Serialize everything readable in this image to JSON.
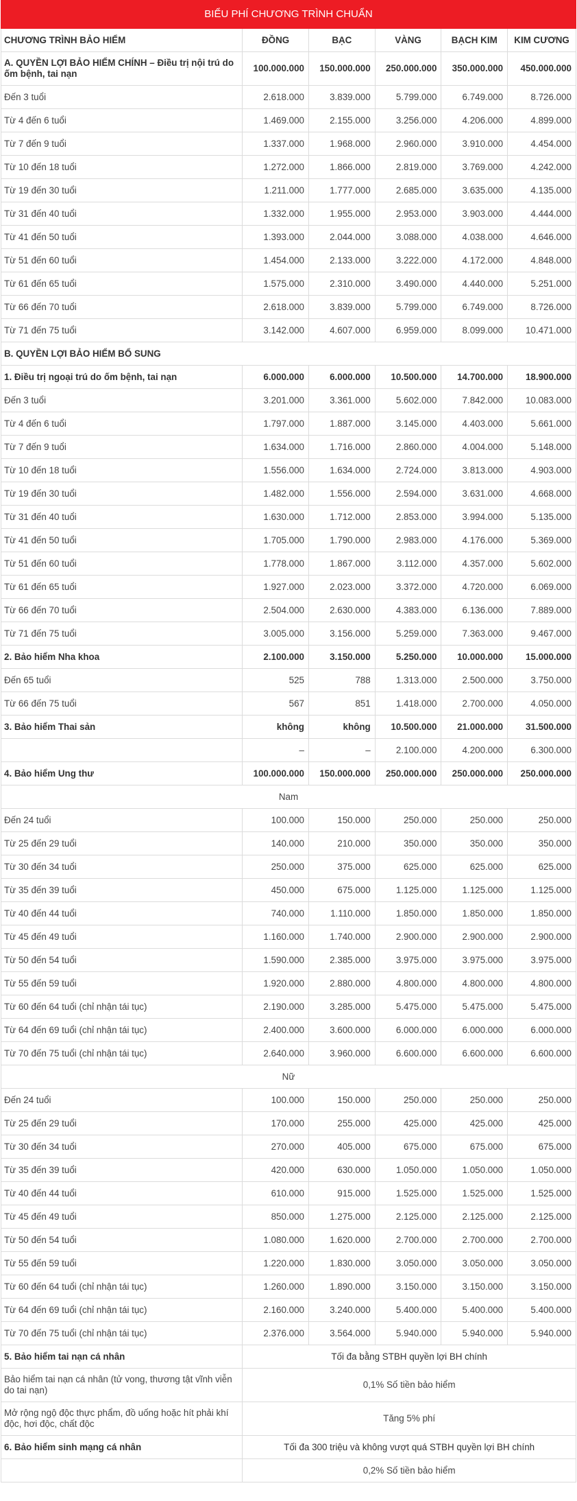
{
  "title": "BIỂU PHÍ CHƯƠNG TRÌNH CHUẨN",
  "headers": [
    "CHƯƠNG TRÌNH BẢO HIỂM",
    "ĐỒNG",
    "BẠC",
    "VÀNG",
    "BẠCH KIM",
    "KIM CƯƠNG"
  ],
  "sectionA": {
    "label": "A. QUYỀN LỢI BẢO HIỂM CHÍNH – Điều trị nội trú do ốm bệnh, tai nạn",
    "values": [
      "100.000.000",
      "150.000.000",
      "250.000.000",
      "350.000.000",
      "450.000.000"
    ],
    "rows": [
      {
        "label": "Đến 3 tuổi",
        "values": [
          "2.618.000",
          "3.839.000",
          "5.799.000",
          "6.749.000",
          "8.726.000"
        ]
      },
      {
        "label": "Từ 4 đến 6 tuổi",
        "values": [
          "1.469.000",
          "2.155.000",
          "3.256.000",
          "4.206.000",
          "4.899.000"
        ]
      },
      {
        "label": "Từ 7 đến 9 tuổi",
        "values": [
          "1.337.000",
          "1.968.000",
          "2.960.000",
          "3.910.000",
          "4.454.000"
        ]
      },
      {
        "label": "Từ 10 đến 18 tuổi",
        "values": [
          "1.272.000",
          "1.866.000",
          "2.819.000",
          "3.769.000",
          "4.242.000"
        ]
      },
      {
        "label": "Từ 19 đến 30 tuổi",
        "values": [
          "1.211.000",
          "1.777.000",
          "2.685.000",
          "3.635.000",
          "4.135.000"
        ]
      },
      {
        "label": "Từ 31 đến 40 tuổi",
        "values": [
          "1.332.000",
          "1.955.000",
          "2.953.000",
          "3.903.000",
          "4.444.000"
        ]
      },
      {
        "label": "Từ 41 đến 50 tuổi",
        "values": [
          "1.393.000",
          "2.044.000",
          "3.088.000",
          "4.038.000",
          "4.646.000"
        ]
      },
      {
        "label": "Từ 51 đến 60 tuổi",
        "values": [
          "1.454.000",
          "2.133.000",
          "3.222.000",
          "4.172.000",
          "4.848.000"
        ]
      },
      {
        "label": "Từ 61 đến 65 tuổi",
        "values": [
          "1.575.000",
          "2.310.000",
          "3.490.000",
          "4.440.000",
          "5.251.000"
        ]
      },
      {
        "label": "Từ 66 đến 70 tuổi",
        "values": [
          "2.618.000",
          "3.839.000",
          "5.799.000",
          "6.749.000",
          "8.726.000"
        ]
      },
      {
        "label": "Từ 71 đến 75 tuổi",
        "values": [
          "3.142.000",
          "4.607.000",
          "6.959.000",
          "8.099.000",
          "10.471.000"
        ]
      }
    ]
  },
  "sectionB": {
    "label": "B. QUYỀN LỢI BẢO HIỂM BỔ SUNG"
  },
  "outpatient": {
    "label": "1. Điều trị ngoại trú do ốm bệnh, tai nạn",
    "values": [
      "6.000.000",
      "6.000.000",
      "10.500.000",
      "14.700.000",
      "18.900.000"
    ],
    "rows": [
      {
        "label": "Đến 3 tuổi",
        "values": [
          "3.201.000",
          "3.361.000",
          "5.602.000",
          "7.842.000",
          "10.083.000"
        ]
      },
      {
        "label": "Từ 4 đến 6 tuổi",
        "values": [
          "1.797.000",
          "1.887.000",
          "3.145.000",
          "4.403.000",
          "5.661.000"
        ]
      },
      {
        "label": "Từ 7 đến 9 tuổi",
        "values": [
          "1.634.000",
          "1.716.000",
          "2.860.000",
          "4.004.000",
          "5.148.000"
        ]
      },
      {
        "label": "Từ 10 đến 18 tuổi",
        "values": [
          "1.556.000",
          "1.634.000",
          "2.724.000",
          "3.813.000",
          "4.903.000"
        ]
      },
      {
        "label": "Từ 19 đến 30 tuổi",
        "values": [
          "1.482.000",
          "1.556.000",
          "2.594.000",
          "3.631.000",
          "4.668.000"
        ]
      },
      {
        "label": "Từ 31 đến 40 tuổi",
        "values": [
          "1.630.000",
          "1.712.000",
          "2.853.000",
          "3.994.000",
          "5.135.000"
        ]
      },
      {
        "label": "Từ 41 đến 50 tuổi",
        "values": [
          "1.705.000",
          "1.790.000",
          "2.983.000",
          "4.176.000",
          "5.369.000"
        ]
      },
      {
        "label": "Từ 51 đến 60 tuổi",
        "values": [
          "1.778.000",
          "1.867.000",
          "3.112.000",
          "4.357.000",
          "5.602.000"
        ]
      },
      {
        "label": "Từ 61 đến 65 tuổi",
        "values": [
          "1.927.000",
          "2.023.000",
          "3.372.000",
          "4.720.000",
          "6.069.000"
        ]
      },
      {
        "label": "Từ 66 đến 70 tuổi",
        "values": [
          "2.504.000",
          "2.630.000",
          "4.383.000",
          "6.136.000",
          "7.889.000"
        ]
      },
      {
        "label": "Từ 71 đến 75 tuổi",
        "values": [
          "3.005.000",
          "3.156.000",
          "5.259.000",
          "7.363.000",
          "9.467.000"
        ]
      }
    ]
  },
  "dental": {
    "label": "2. Bảo hiểm Nha khoa",
    "values": [
      "2.100.000",
      "3.150.000",
      "5.250.000",
      "10.000.000",
      "15.000.000"
    ],
    "rows": [
      {
        "label": "Đến 65 tuổi",
        "values": [
          "525",
          "788",
          "1.313.000",
          "2.500.000",
          "3.750.000"
        ]
      },
      {
        "label": "Từ 66 đến 75 tuổi",
        "values": [
          "567",
          "851",
          "1.418.000",
          "2.700.000",
          "4.050.000"
        ]
      }
    ]
  },
  "maternity": {
    "label": "3. Bảo hiểm Thai sản",
    "values": [
      "không",
      "không",
      "10.500.000",
      "21.000.000",
      "31.500.000"
    ],
    "rows": [
      {
        "label": "",
        "values": [
          "–",
          "–",
          "2.100.000",
          "4.200.000",
          "6.300.000"
        ]
      }
    ]
  },
  "cancer": {
    "label": "4. Bảo hiểm Ung thư",
    "values": [
      "100.000.000",
      "150.000.000",
      "250.000.000",
      "250.000.000",
      "250.000.000"
    ],
    "male_label": "Nam",
    "male": [
      {
        "label": "Đến 24 tuổi",
        "values": [
          "100.000",
          "150.000",
          "250.000",
          "250.000",
          "250.000"
        ]
      },
      {
        "label": "Từ 25 đến 29 tuổi",
        "values": [
          "140.000",
          "210.000",
          "350.000",
          "350.000",
          "350.000"
        ]
      },
      {
        "label": "Từ 30 đến 34 tuổi",
        "values": [
          "250.000",
          "375.000",
          "625.000",
          "625.000",
          "625.000"
        ]
      },
      {
        "label": "Từ 35 đến 39 tuổi",
        "values": [
          "450.000",
          "675.000",
          "1.125.000",
          "1.125.000",
          "1.125.000"
        ]
      },
      {
        "label": "Từ 40 đến 44 tuổi",
        "values": [
          "740.000",
          "1.110.000",
          "1.850.000",
          "1.850.000",
          "1.850.000"
        ]
      },
      {
        "label": "Từ 45 đến 49 tuổi",
        "values": [
          "1.160.000",
          "1.740.000",
          "2.900.000",
          "2.900.000",
          "2.900.000"
        ]
      },
      {
        "label": "Từ 50 đến 54 tuổi",
        "values": [
          "1.590.000",
          "2.385.000",
          "3.975.000",
          "3.975.000",
          "3.975.000"
        ]
      },
      {
        "label": "Từ 55 đến 59 tuổi",
        "values": [
          "1.920.000",
          "2.880.000",
          "4.800.000",
          "4.800.000",
          "4.800.000"
        ]
      },
      {
        "label": "Từ 60 đến 64 tuổi (chỉ nhận tái tục)",
        "values": [
          "2.190.000",
          "3.285.000",
          "5.475.000",
          "5.475.000",
          "5.475.000"
        ]
      },
      {
        "label": "Từ 64 đến 69 tuổi (chỉ nhận tái tục)",
        "values": [
          "2.400.000",
          "3.600.000",
          "6.000.000",
          "6.000.000",
          "6.000.000"
        ]
      },
      {
        "label": "Từ 70 đến 75 tuổi (chỉ nhận tái tục)",
        "values": [
          "2.640.000",
          "3.960.000",
          "6.600.000",
          "6.600.000",
          "6.600.000"
        ]
      }
    ],
    "female_label": "Nữ",
    "female": [
      {
        "label": "Đến 24 tuổi",
        "values": [
          "100.000",
          "150.000",
          "250.000",
          "250.000",
          "250.000"
        ]
      },
      {
        "label": "Từ 25 đến 29 tuổi",
        "values": [
          "170.000",
          "255.000",
          "425.000",
          "425.000",
          "425.000"
        ]
      },
      {
        "label": "Từ 30 đến 34 tuổi",
        "values": [
          "270.000",
          "405.000",
          "675.000",
          "675.000",
          "675.000"
        ]
      },
      {
        "label": "Từ 35 đến 39 tuổi",
        "values": [
          "420.000",
          "630.000",
          "1.050.000",
          "1.050.000",
          "1.050.000"
        ]
      },
      {
        "label": "Từ 40 đến 44 tuổi",
        "values": [
          "610.000",
          "915.000",
          "1.525.000",
          "1.525.000",
          "1.525.000"
        ]
      },
      {
        "label": "Từ 45 đến 49 tuổi",
        "values": [
          "850.000",
          "1.275.000",
          "2.125.000",
          "2.125.000",
          "2.125.000"
        ]
      },
      {
        "label": "Từ 50 đến 54 tuổi",
        "values": [
          "1.080.000",
          "1.620.000",
          "2.700.000",
          "2.700.000",
          "2.700.000"
        ]
      },
      {
        "label": "Từ 55 đến 59 tuổi",
        "values": [
          "1.220.000",
          "1.830.000",
          "3.050.000",
          "3.050.000",
          "3.050.000"
        ]
      },
      {
        "label": "Từ 60 đến 64 tuổi (chỉ nhận tái tục)",
        "values": [
          "1.260.000",
          "1.890.000",
          "3.150.000",
          "3.150.000",
          "3.150.000"
        ]
      },
      {
        "label": "Từ 64 đến 69 tuổi (chỉ nhận tái tục)",
        "values": [
          "2.160.000",
          "3.240.000",
          "5.400.000",
          "5.400.000",
          "5.400.000"
        ]
      },
      {
        "label": "Từ 70 đến 75 tuổi (chỉ nhận tái tục)",
        "values": [
          "2.376.000",
          "3.564.000",
          "5.940.000",
          "5.940.000",
          "5.940.000"
        ]
      }
    ]
  },
  "accident": {
    "label": "5. Bảo hiểm tai nạn cá nhân",
    "value": "Tối đa bằng STBH quyền lợi BH chính",
    "rows": [
      {
        "label": "Bảo hiểm tai nạn cá nhân (tử vong, thương tật vĩnh viễn do tai nạn)",
        "value": "0,1% Số tiền bảo hiểm"
      },
      {
        "label": "Mở rộng ngộ độc thực phẩm, đồ uống hoặc hít phải khí độc, hơi độc, chất độc",
        "value": "Tăng 5% phí"
      }
    ]
  },
  "life": {
    "label": "6. Bảo hiểm sinh mạng cá nhân",
    "value": "Tối đa 300 triệu và không vượt quá STBH quyền lợi BH chính",
    "rows": [
      {
        "label": "",
        "value": "0,2% Số tiền bảo hiểm"
      }
    ]
  }
}
